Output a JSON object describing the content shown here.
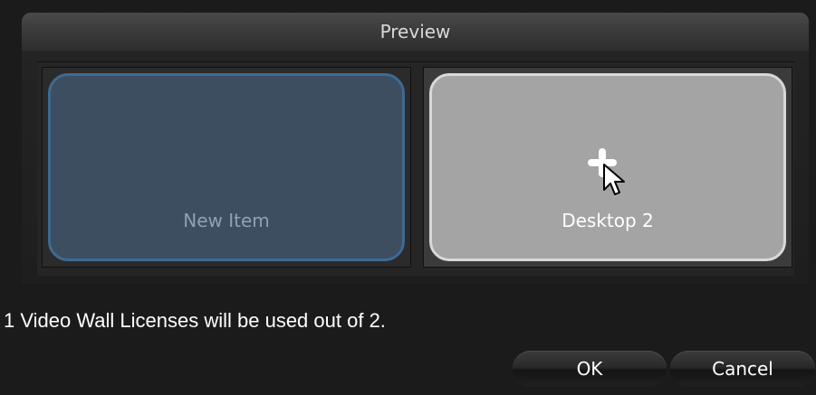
{
  "preview": {
    "title": "Preview",
    "tiles": [
      {
        "label": "New Item",
        "state": "empty"
      },
      {
        "label": "Desktop 2",
        "state": "selected"
      }
    ],
    "cursor_icon": "move-cursor-icon"
  },
  "footer": {
    "license_text": "1 Video Wall Licenses will be used out of 2."
  },
  "buttons": {
    "ok_label": "OK",
    "cancel_label": "Cancel"
  },
  "colors": {
    "background": "#1b1b1b",
    "tile_empty_fill": "#3c4e60",
    "tile_empty_border": "#3e6a93",
    "tile_selected_fill": "#a4a4a4",
    "tile_selected_border": "#d8d8d8"
  }
}
